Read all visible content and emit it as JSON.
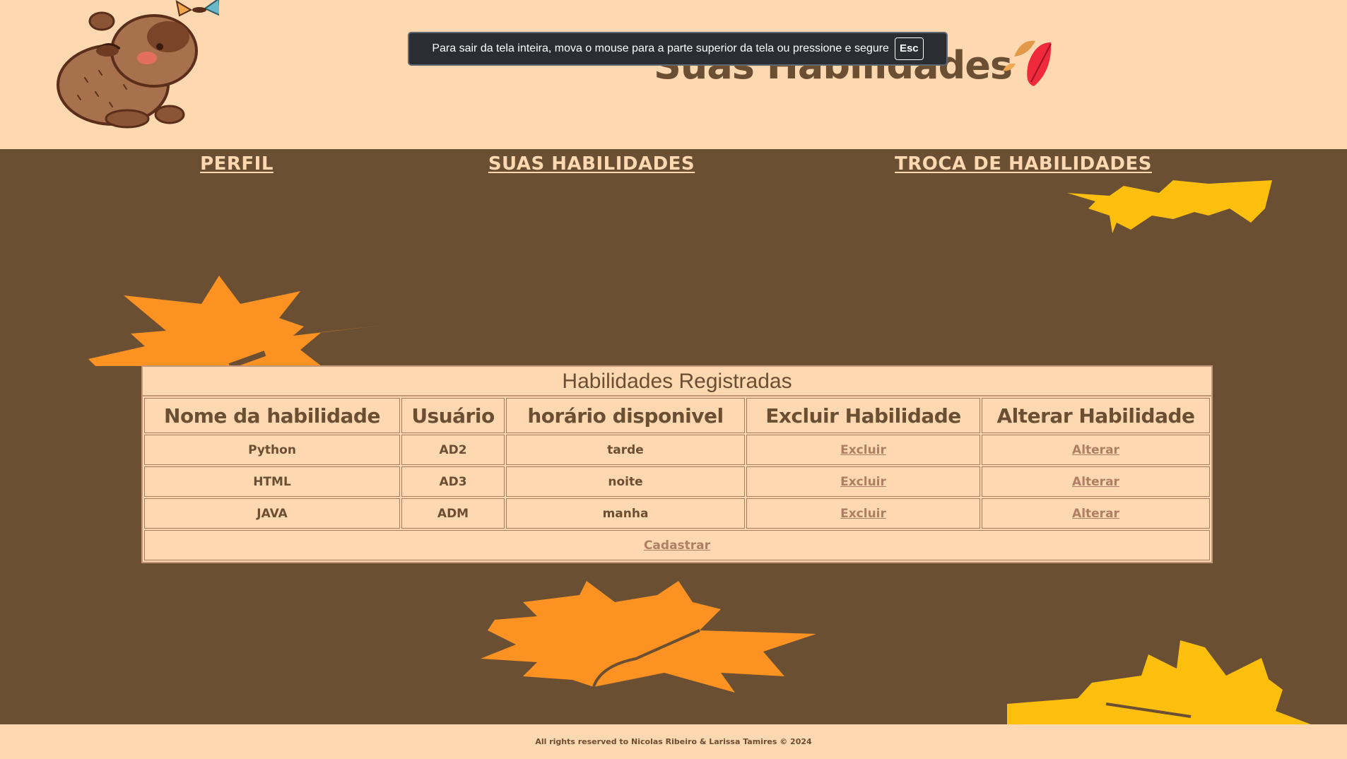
{
  "header": {
    "title": "Suas Habilidades"
  },
  "fullscreen_notice": {
    "message": "Para sair da tela inteira, mova o mouse para a parte superior da tela ou pressione e segure",
    "key": "Esc"
  },
  "nav": {
    "items": [
      {
        "label": "PERFIL"
      },
      {
        "label": "SUAS HABILIDADES"
      },
      {
        "label": "TROCA DE HABILIDADES"
      }
    ]
  },
  "table": {
    "caption": "Habilidades Registradas",
    "headers": [
      "Nome da habilidade",
      "Usuário",
      "horário disponivel",
      "Excluir Habilidade",
      "Alterar Habilidade"
    ],
    "rows": [
      {
        "name": "Python",
        "user": "AD2",
        "time": "tarde",
        "delete": "Excluir",
        "edit": "Alterar"
      },
      {
        "name": "HTML",
        "user": "AD3",
        "time": "noite",
        "delete": "Excluir",
        "edit": "Alterar"
      },
      {
        "name": "JAVA",
        "user": "ADM",
        "time": "manha",
        "delete": "Excluir",
        "edit": "Alterar"
      }
    ],
    "register_link": "Cadastrar"
  },
  "footer": {
    "text": "All rights reserved to Nicolas Ribeiro & Larissa Tamires © 2024"
  },
  "colors": {
    "background_brown": "#6b4f33",
    "cream": "#fed8b1",
    "orange_leaf": "#fb9221",
    "yellow_leaf": "#fdbf0e",
    "link": "#b07e64"
  },
  "icons": {
    "mascot": "capybara-with-butterfly-icon",
    "title": "falling-leaves-icon",
    "background": "maple-leaf-icon"
  }
}
